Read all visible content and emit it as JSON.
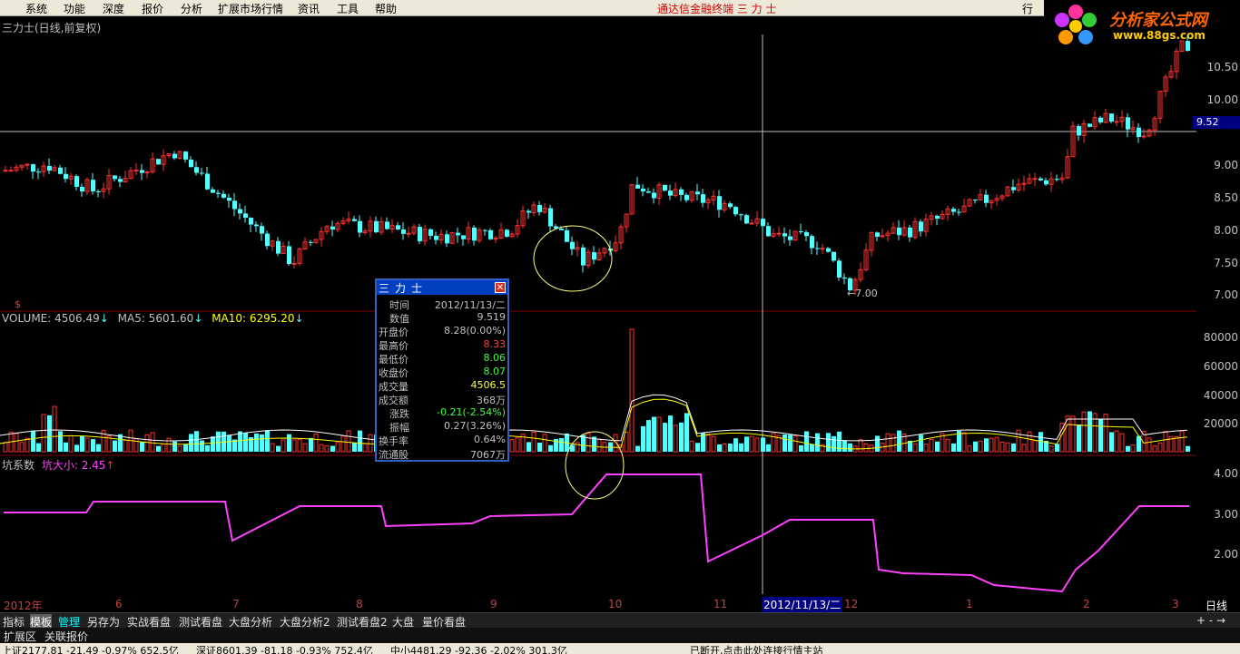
{
  "menu": [
    "系统",
    "功能",
    "深度",
    "报价",
    "分析",
    "扩展市场行情",
    "资讯",
    "工具",
    "帮助"
  ],
  "app_title": "通达信金融终端  三 力 士",
  "menu_extra": "行",
  "logo": {
    "text": "分析家公式网",
    "url": "www.88gs.com"
  },
  "stock_title": "三力士(日线,前复权)",
  "price_axis": [
    "10.50",
    "10.00",
    "9.52",
    "9.00",
    "8.50",
    "8.00",
    "7.50",
    "7.00"
  ],
  "price_tag": "9.52",
  "low_mark": "←7.00",
  "volume_line": {
    "label": "VOLUME: 4506.49",
    "ma5": "MA5: 5601.60",
    "ma10": "MA10: 6295.20"
  },
  "volume_axis": [
    "80000",
    "60000",
    "40000",
    "20000"
  ],
  "pit_line": {
    "label": "坑系数",
    "pit": "坑大小: 2.45"
  },
  "pit_axis": [
    "4.00",
    "3.00",
    "2.00"
  ],
  "x_axis": [
    "2012年",
    "6",
    "7",
    "8",
    "9",
    "10",
    "11",
    "12",
    "1",
    "2",
    "3"
  ],
  "cursor_date": "2012/11/13/二",
  "daily_label": "日线",
  "popup": {
    "title": "三力士",
    "rows": [
      {
        "label": "时间",
        "value": "2012/11/13/二",
        "color": "#c0c0c0"
      },
      {
        "label": "数值",
        "value": "9.519",
        "color": "#c0c0c0"
      },
      {
        "label": "开盘价",
        "value": "8.28(0.00%)",
        "color": "#c0c0c0"
      },
      {
        "label": "最高价",
        "value": "8.33",
        "color": "#ff4040"
      },
      {
        "label": "最低价",
        "value": "8.06",
        "color": "#40ff40"
      },
      {
        "label": "收盘价",
        "value": "8.07",
        "color": "#40ff40"
      },
      {
        "label": "成交量",
        "value": "4506.5",
        "color": "#ffff40"
      },
      {
        "label": "成交额",
        "value": "368万",
        "color": "#c0c0c0"
      },
      {
        "label": "涨跌",
        "value": "-0.21(-2.54%)",
        "color": "#40ff40"
      },
      {
        "label": "振幅",
        "value": "0.27(3.26%)",
        "color": "#c0c0c0"
      },
      {
        "label": "换手率",
        "value": "0.64%",
        "color": "#c0c0c0"
      },
      {
        "label": "流通股",
        "value": "7067万",
        "color": "#c0c0c0"
      }
    ]
  },
  "tabs": [
    "指标",
    "模板",
    "管理",
    "另存为",
    "实战看盘",
    "测试看盘",
    "大盘分析",
    "大盘分析2",
    "测试看盘2",
    "大盘",
    "量价看盘"
  ],
  "tab_controls": "+  -  →",
  "ext_tabs": [
    "扩展区",
    "关联报价"
  ],
  "status": {
    "sh": "上证2177.81  -21.49  -0.97%  652.5亿",
    "sz": "深证8601.39  -81.18  -0.93%  752.4亿",
    "mid": "中小4481.29  -92.36  -2.02%  301.3亿",
    "msg": "已断开,点击此处连接行情主站"
  },
  "colors": {
    "up": "#ff3030",
    "down": "#54ffff",
    "pit_line": "#ff40ff",
    "ma_white": "#ffffff",
    "ma_yellow": "#ffff00"
  }
}
